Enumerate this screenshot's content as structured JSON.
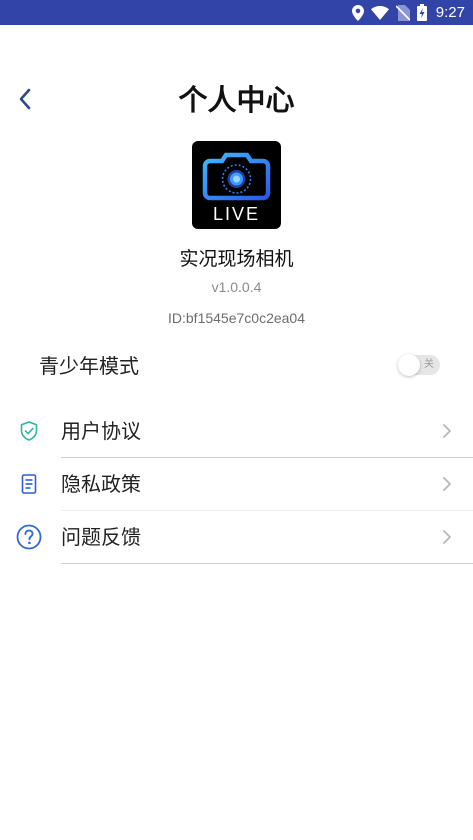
{
  "status_bar": {
    "time": "9:27",
    "background_color": "#3344a8",
    "icons": [
      "location-icon",
      "wifi-icon",
      "no-sim-icon",
      "battery-charging-icon"
    ]
  },
  "header": {
    "title": "个人中心",
    "back_icon": "chevron-left-icon"
  },
  "app_info": {
    "icon_label": "LIVE",
    "name": "实况现场相机",
    "version": "v1.0.0.4",
    "id": "ID:bf1545e7c0c2ea04"
  },
  "youth_mode": {
    "label": "青少年模式",
    "toggle_state": "off",
    "toggle_text": "关"
  },
  "menu": {
    "items": [
      {
        "label": "用户协议",
        "icon": "shield-check-icon",
        "icon_color": "#2bb5a5"
      },
      {
        "label": "隐私政策",
        "icon": "document-icon",
        "icon_color": "#2f5fd6"
      },
      {
        "label": "问题反馈",
        "icon": "question-circle-icon",
        "icon_color": "#2f6ad6"
      }
    ]
  },
  "colors": {
    "accent": "#2f5fd6",
    "back_icon": "#2f4a8a"
  }
}
